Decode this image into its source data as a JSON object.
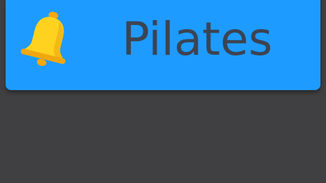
{
  "notification": {
    "title": "Pilates",
    "icon": "bell-icon"
  },
  "colors": {
    "banner": "#1e9bff",
    "background": "#404042",
    "title_text": "#3c4452",
    "bell": "#ffd21f",
    "bell_shadow": "#f1a70f"
  }
}
